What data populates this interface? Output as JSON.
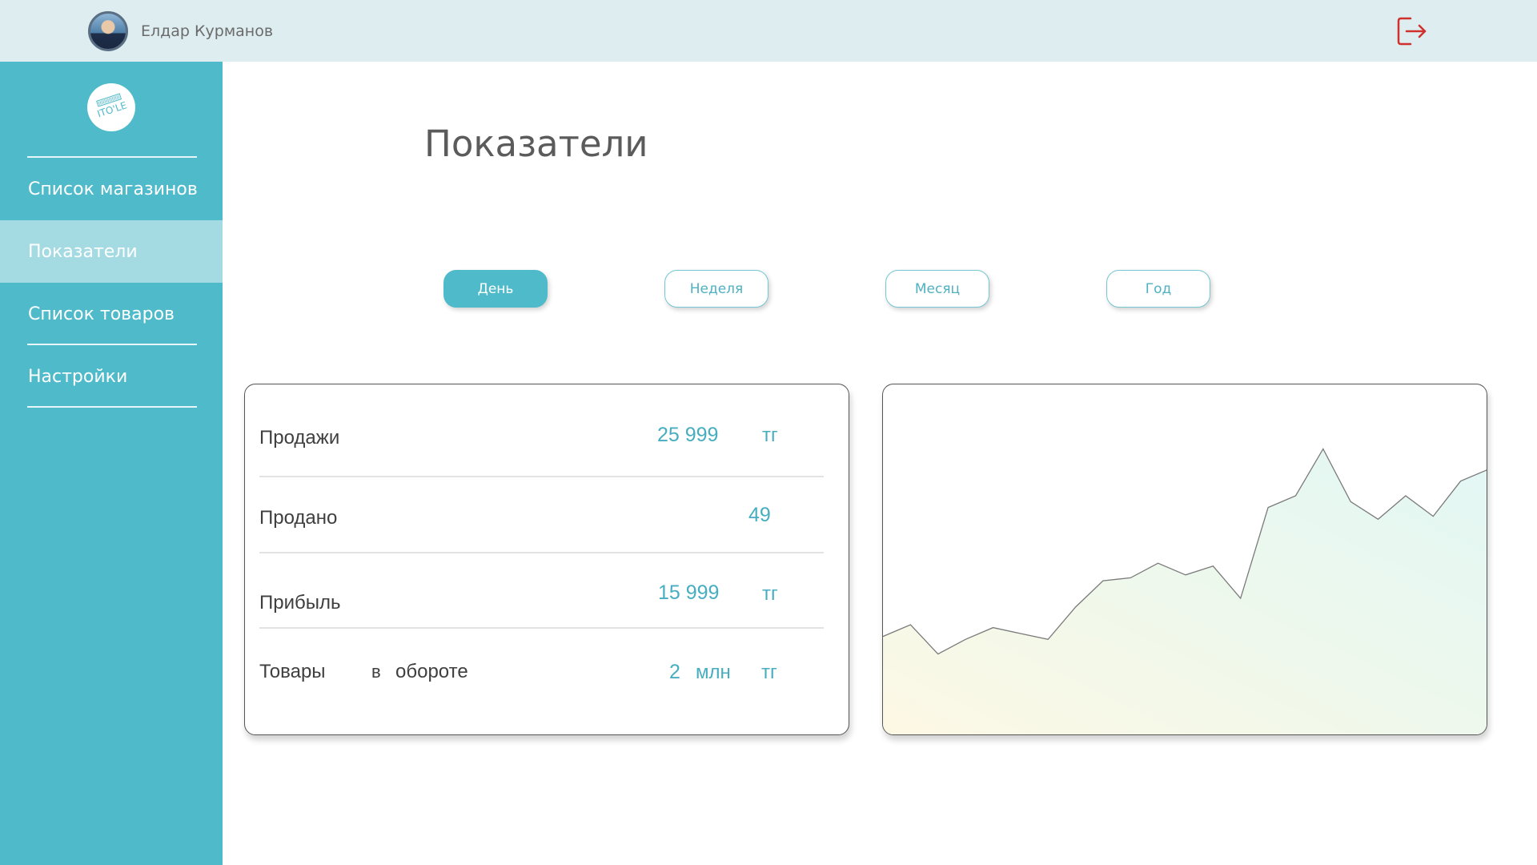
{
  "header": {
    "user_name": "Елдар Курманов",
    "logout_icon": "logout-icon",
    "logout_color": "#d0312d"
  },
  "sidebar": {
    "logo_text": "ITO'LE",
    "items": [
      {
        "label": "Список магазинов",
        "active": false
      },
      {
        "label": "Показатели",
        "active": true
      },
      {
        "label": "Список товаров",
        "active": false
      },
      {
        "label": "Настройки",
        "active": false
      }
    ]
  },
  "main": {
    "title": "Показатели",
    "periods": [
      {
        "label": "День",
        "active": true
      },
      {
        "label": "Неделя",
        "active": false
      },
      {
        "label": "Месяц",
        "active": false
      },
      {
        "label": "Год",
        "active": false
      }
    ],
    "stats": {
      "sales": {
        "label": "Продажи",
        "value": "25 999",
        "unit": "тг"
      },
      "sold": {
        "label": "Продано",
        "value": "49"
      },
      "profit": {
        "label": "Прибыль",
        "value": "15 999",
        "unit": "тг"
      },
      "turnover": {
        "label_1": "Товары",
        "label_2": "в",
        "label_3": "обороте",
        "value": "2",
        "value_unit": "млн",
        "unit": "тг"
      }
    }
  },
  "colors": {
    "accent": "#4fbaca",
    "accent_light": "#a4dbe3",
    "value_text": "#47adc0"
  },
  "chart_data": {
    "type": "area",
    "title": "",
    "xlabel": "",
    "ylabel": "",
    "x": [
      0,
      1,
      2,
      3,
      4,
      5,
      6,
      7,
      8,
      9,
      10,
      11,
      12,
      13,
      14,
      15,
      16,
      17,
      18,
      19,
      20,
      21,
      22
    ],
    "values": [
      34,
      38,
      28,
      33,
      37,
      35,
      33,
      44,
      53,
      54,
      59,
      55,
      58,
      47,
      78,
      82,
      98,
      80,
      74,
      82,
      75,
      87,
      91
    ],
    "ylim": [
      0,
      120
    ],
    "grid": false
  }
}
